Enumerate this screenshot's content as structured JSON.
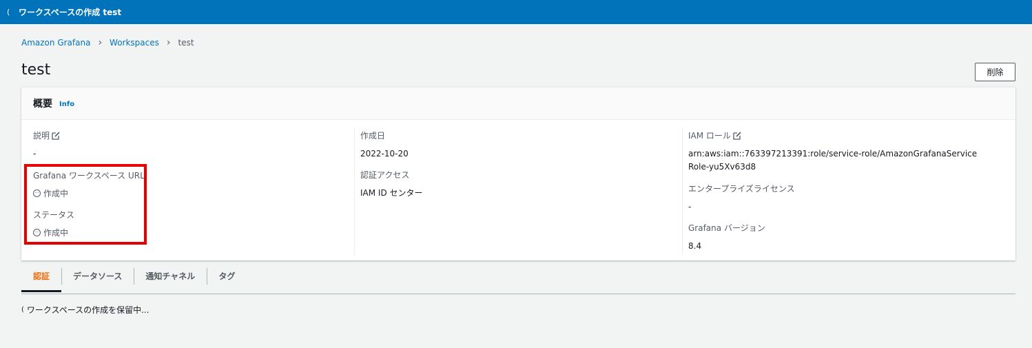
{
  "banner": {
    "title": "ワークスペースの作成 test",
    "spinner": "("
  },
  "breadcrumb": {
    "items": [
      "Amazon Grafana",
      "Workspaces"
    ],
    "current": "test"
  },
  "page": {
    "title": "test",
    "delete_label": "削除"
  },
  "overview": {
    "title": "概要",
    "info": "Info",
    "description": {
      "label": "説明",
      "value": "-"
    },
    "grafana_url": {
      "label": "Grafana ワークスペース URL",
      "value": "作成中"
    },
    "status": {
      "label": "ステータス",
      "value": "作成中"
    },
    "created": {
      "label": "作成日",
      "value": "2022-10-20"
    },
    "auth_access": {
      "label": "認証アクセス",
      "value": "IAM ID センター"
    },
    "iam_role": {
      "label": "IAM ロール",
      "value": "arn:aws:iam::763397213391:role/service-role/AmazonGrafanaServiceRole-yu5Xv63d8"
    },
    "enterprise_license": {
      "label": "エンタープライズライセンス",
      "value": "-"
    },
    "grafana_version": {
      "label": "Grafana バージョン",
      "value": "8.4"
    }
  },
  "tabs": [
    "認証",
    "データソース",
    "通知チャネル",
    "タグ"
  ],
  "pending_message": "ワークスペースの作成を保留中...",
  "colors": {
    "banner": "#0073bb",
    "active_tab": "#ec7211",
    "highlight": "#e60000",
    "link": "#0073bb"
  }
}
